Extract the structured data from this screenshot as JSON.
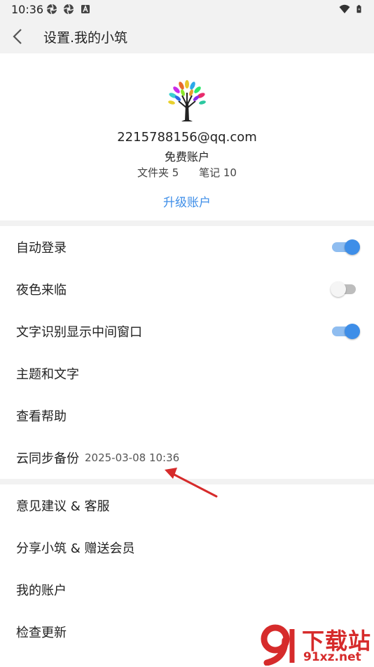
{
  "status_bar": {
    "time": "10:36",
    "left_icons": [
      "app-notification-icon",
      "app-notification-icon",
      "a-letter-icon"
    ],
    "right_icons": [
      "wifi-icon",
      "battery-icon"
    ]
  },
  "app_bar": {
    "back_icon": "chevron-left-icon",
    "title": "设置.我的小筑"
  },
  "profile": {
    "avatar_icon": "colorful-tree-icon",
    "email": "2215788156@qq.com",
    "plan": "免费账户",
    "folders": "文件夹 5",
    "notes": "笔记 10",
    "upgrade_label": "升级账户"
  },
  "settings": {
    "auto_login": {
      "label": "自动登录",
      "enabled": true
    },
    "night_mode": {
      "label": "夜色来临",
      "enabled": false
    },
    "ocr_window": {
      "label": "文字识别显示中间窗口",
      "enabled": true
    },
    "theme": {
      "label": "主题和文字"
    },
    "help": {
      "label": "查看帮助"
    },
    "cloud_sync": {
      "label": "云同步备份",
      "timestamp": "2025-03-08 10:36"
    }
  },
  "more": {
    "feedback": "意见建议 & 客服",
    "share": "分享小筑 & 赠送会员",
    "account": "我的账户",
    "update": "检查更新"
  },
  "watermark": {
    "line1": "下载站",
    "line2": "91xz.net"
  },
  "colors": {
    "accent": "#3e8ee8",
    "annotation": "#d62b2b"
  }
}
